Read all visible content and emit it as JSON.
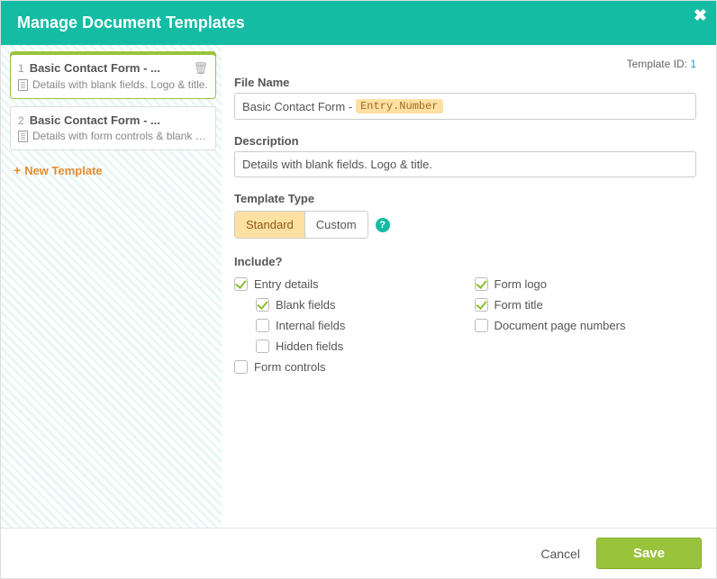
{
  "header": {
    "title": "Manage Document Templates"
  },
  "sidebar": {
    "templates": [
      {
        "num": "1",
        "title": "Basic Contact Form - ...",
        "desc": "Details with blank fields. Logo & title.",
        "selected": true,
        "trash": true
      },
      {
        "num": "2",
        "title": "Basic Contact Form - ...",
        "desc": "Details with form controls & blank fi...",
        "selected": false,
        "trash": false
      }
    ],
    "new_template": "New Template"
  },
  "main": {
    "template_id_label": "Template ID:",
    "template_id_value": "1",
    "file_name_label": "File Name",
    "file_name_prefix": "Basic Contact Form -",
    "file_name_chip": "Entry.Number",
    "description_label": "Description",
    "description_value": "Details with blank fields. Logo & title.",
    "template_type_label": "Template Type",
    "type_standard": "Standard",
    "type_custom": "Custom",
    "include_label": "Include?",
    "left": {
      "entry_details": "Entry details",
      "blank_fields": "Blank fields",
      "internal_fields": "Internal fields",
      "hidden_fields": "Hidden fields",
      "form_controls": "Form controls"
    },
    "right": {
      "form_logo": "Form logo",
      "form_title": "Form title",
      "page_numbers": "Document page numbers"
    }
  },
  "footer": {
    "cancel": "Cancel",
    "save": "Save"
  }
}
